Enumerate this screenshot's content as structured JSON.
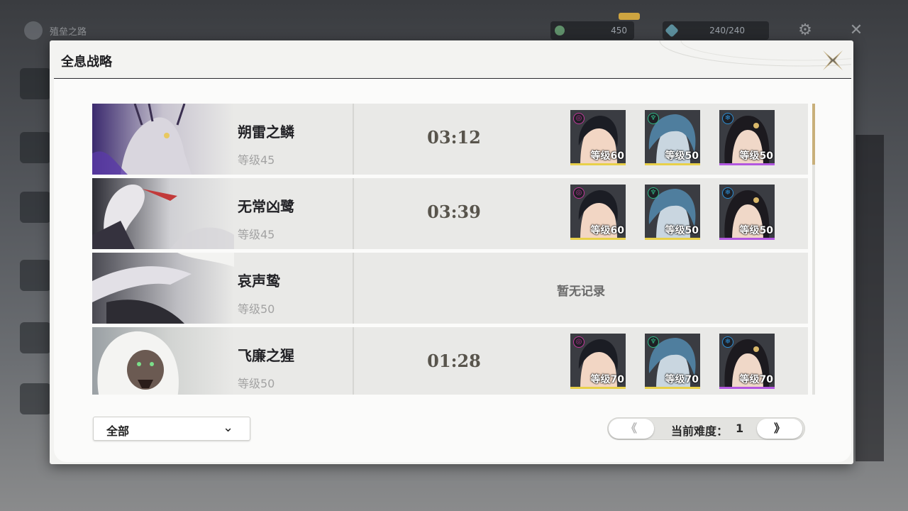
{
  "background": {
    "title": "殖垒之路",
    "resource1": "450",
    "resource2": "240/240"
  },
  "dialog": {
    "title": "全息战略"
  },
  "entries": [
    {
      "name": "朔雷之鳞",
      "level": "等级45",
      "time": "03:12",
      "team": [
        {
          "level": "等级60",
          "element": "electro",
          "element_color": "#c2379b",
          "bar_color": "#e8d04a"
        },
        {
          "level": "等级50",
          "element": "aero",
          "element_color": "#2fb886",
          "bar_color": "#e8d04a"
        },
        {
          "level": "等级50",
          "element": "glacio",
          "element_color": "#2d8fd6",
          "bar_color": "#b358e0"
        }
      ]
    },
    {
      "name": "无常凶鹭",
      "level": "等级45",
      "time": "03:39",
      "team": [
        {
          "level": "等级60",
          "element": "electro",
          "element_color": "#c2379b",
          "bar_color": "#e8d04a"
        },
        {
          "level": "等级50",
          "element": "aero",
          "element_color": "#2fb886",
          "bar_color": "#e8d04a"
        },
        {
          "level": "等级50",
          "element": "glacio",
          "element_color": "#2d8fd6",
          "bar_color": "#b358e0"
        }
      ]
    },
    {
      "name": "哀声鸷",
      "level": "等级50",
      "no_record": "暂无记录"
    },
    {
      "name": "飞廉之猩",
      "level": "等级50",
      "time": "01:28",
      "team": [
        {
          "level": "等级70",
          "element": "electro",
          "element_color": "#c2379b",
          "bar_color": "#e8d04a"
        },
        {
          "level": "等级70",
          "element": "aero",
          "element_color": "#2fb886",
          "bar_color": "#e8d04a"
        },
        {
          "level": "等级70",
          "element": "glacio",
          "element_color": "#2d8fd6",
          "bar_color": "#b358e0"
        }
      ]
    }
  ],
  "footer": {
    "filter_label": "全部",
    "prev_label": "《",
    "next_label": "》",
    "difficulty_label": "当前难度：",
    "difficulty_value": "1"
  }
}
